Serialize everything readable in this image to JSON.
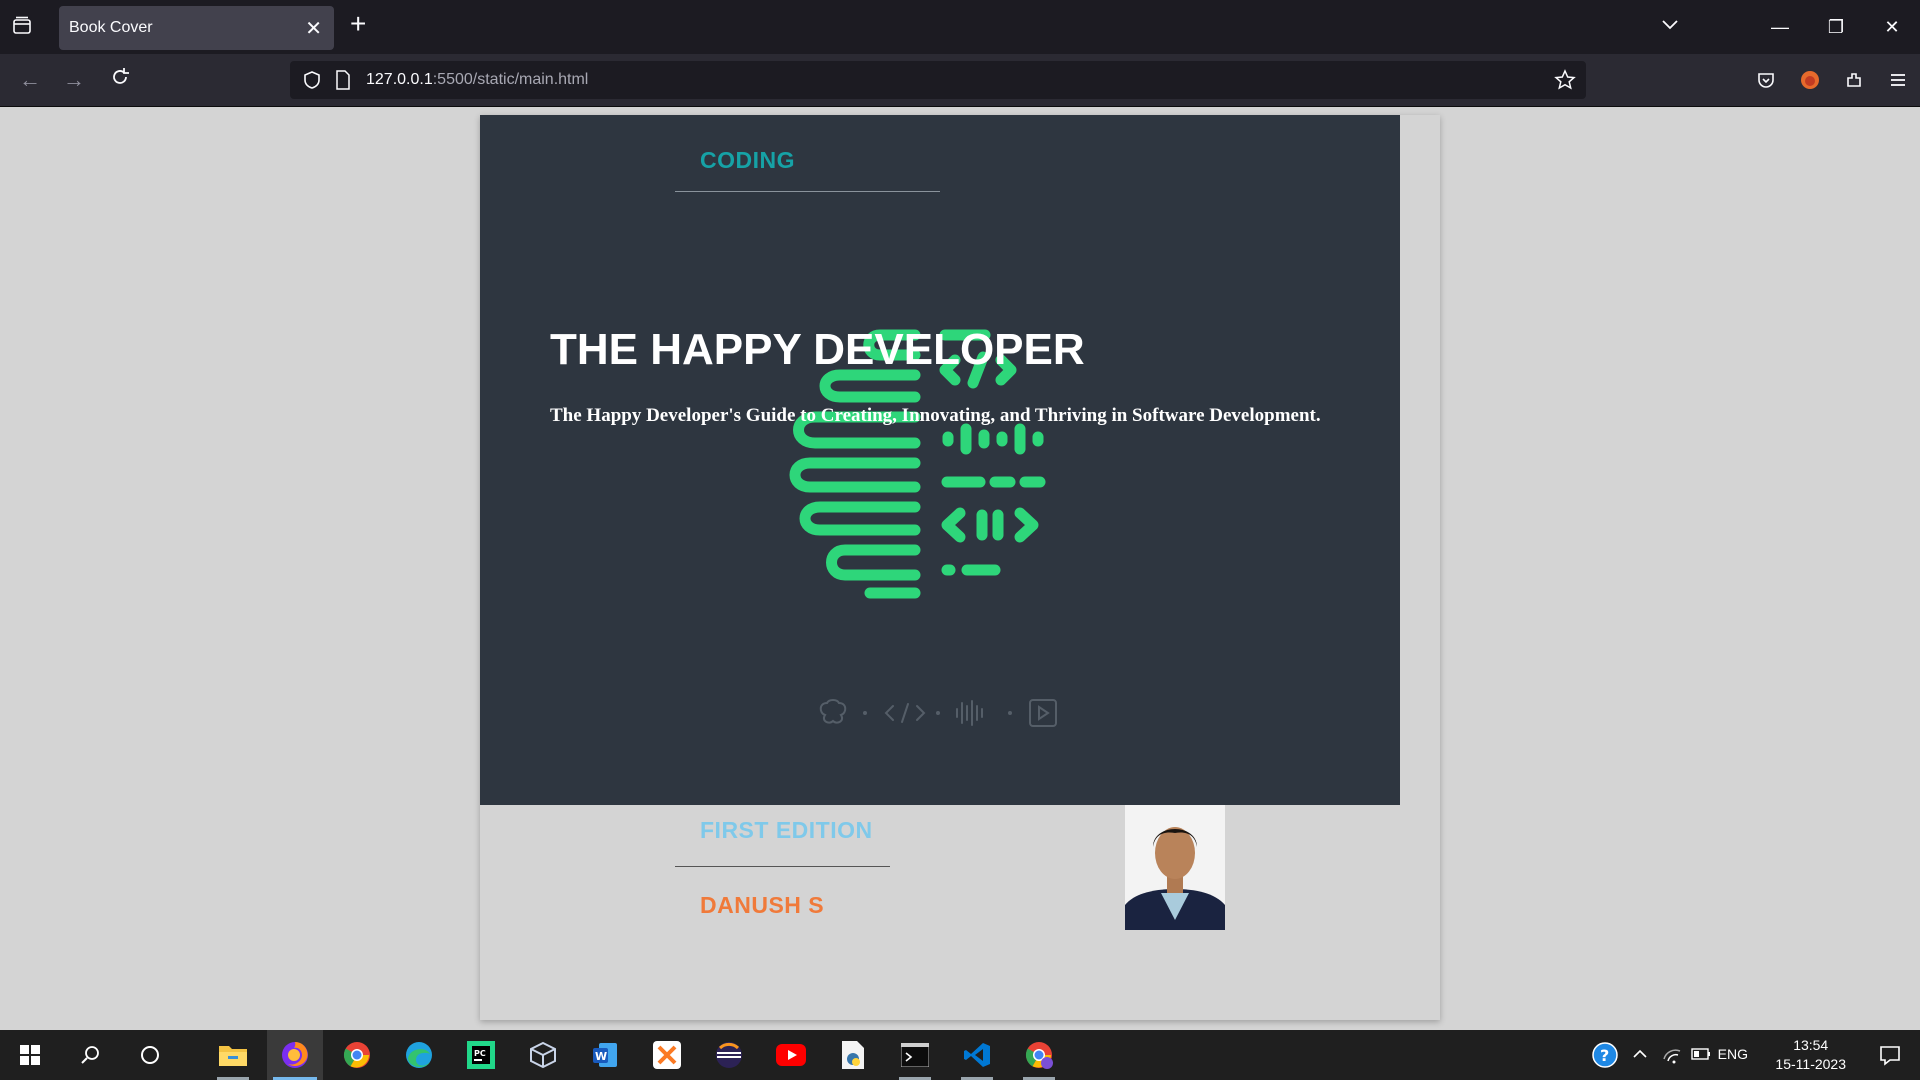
{
  "browser": {
    "tab_title": "Book Cover",
    "url_host": "127.0.0.1",
    "url_path": ":5500/static/main.html"
  },
  "book": {
    "category": "CODING",
    "title": "THE HAPPY DEVELOPER",
    "subtitle": "The Happy Developer's Guide to Creating, Innovating, and Thriving in Software Development.",
    "edition": "FIRST EDITION",
    "author": "DANUSH S",
    "colors": {
      "cover_bg": "#2e3640",
      "category": "#16a2a6",
      "logo": "#2ed67a",
      "edition": "#7fc9ea",
      "author": "#f07a3a"
    }
  },
  "taskbar": {
    "apps": [
      "file-explorer",
      "firefox",
      "chrome",
      "edge",
      "pycharm",
      "virtualbox",
      "word",
      "xampp",
      "eclipse",
      "youtube",
      "python-file",
      "terminal",
      "vscode",
      "chrome-profile"
    ],
    "language": "ENG",
    "time": "13:54",
    "date": "15-11-2023"
  }
}
